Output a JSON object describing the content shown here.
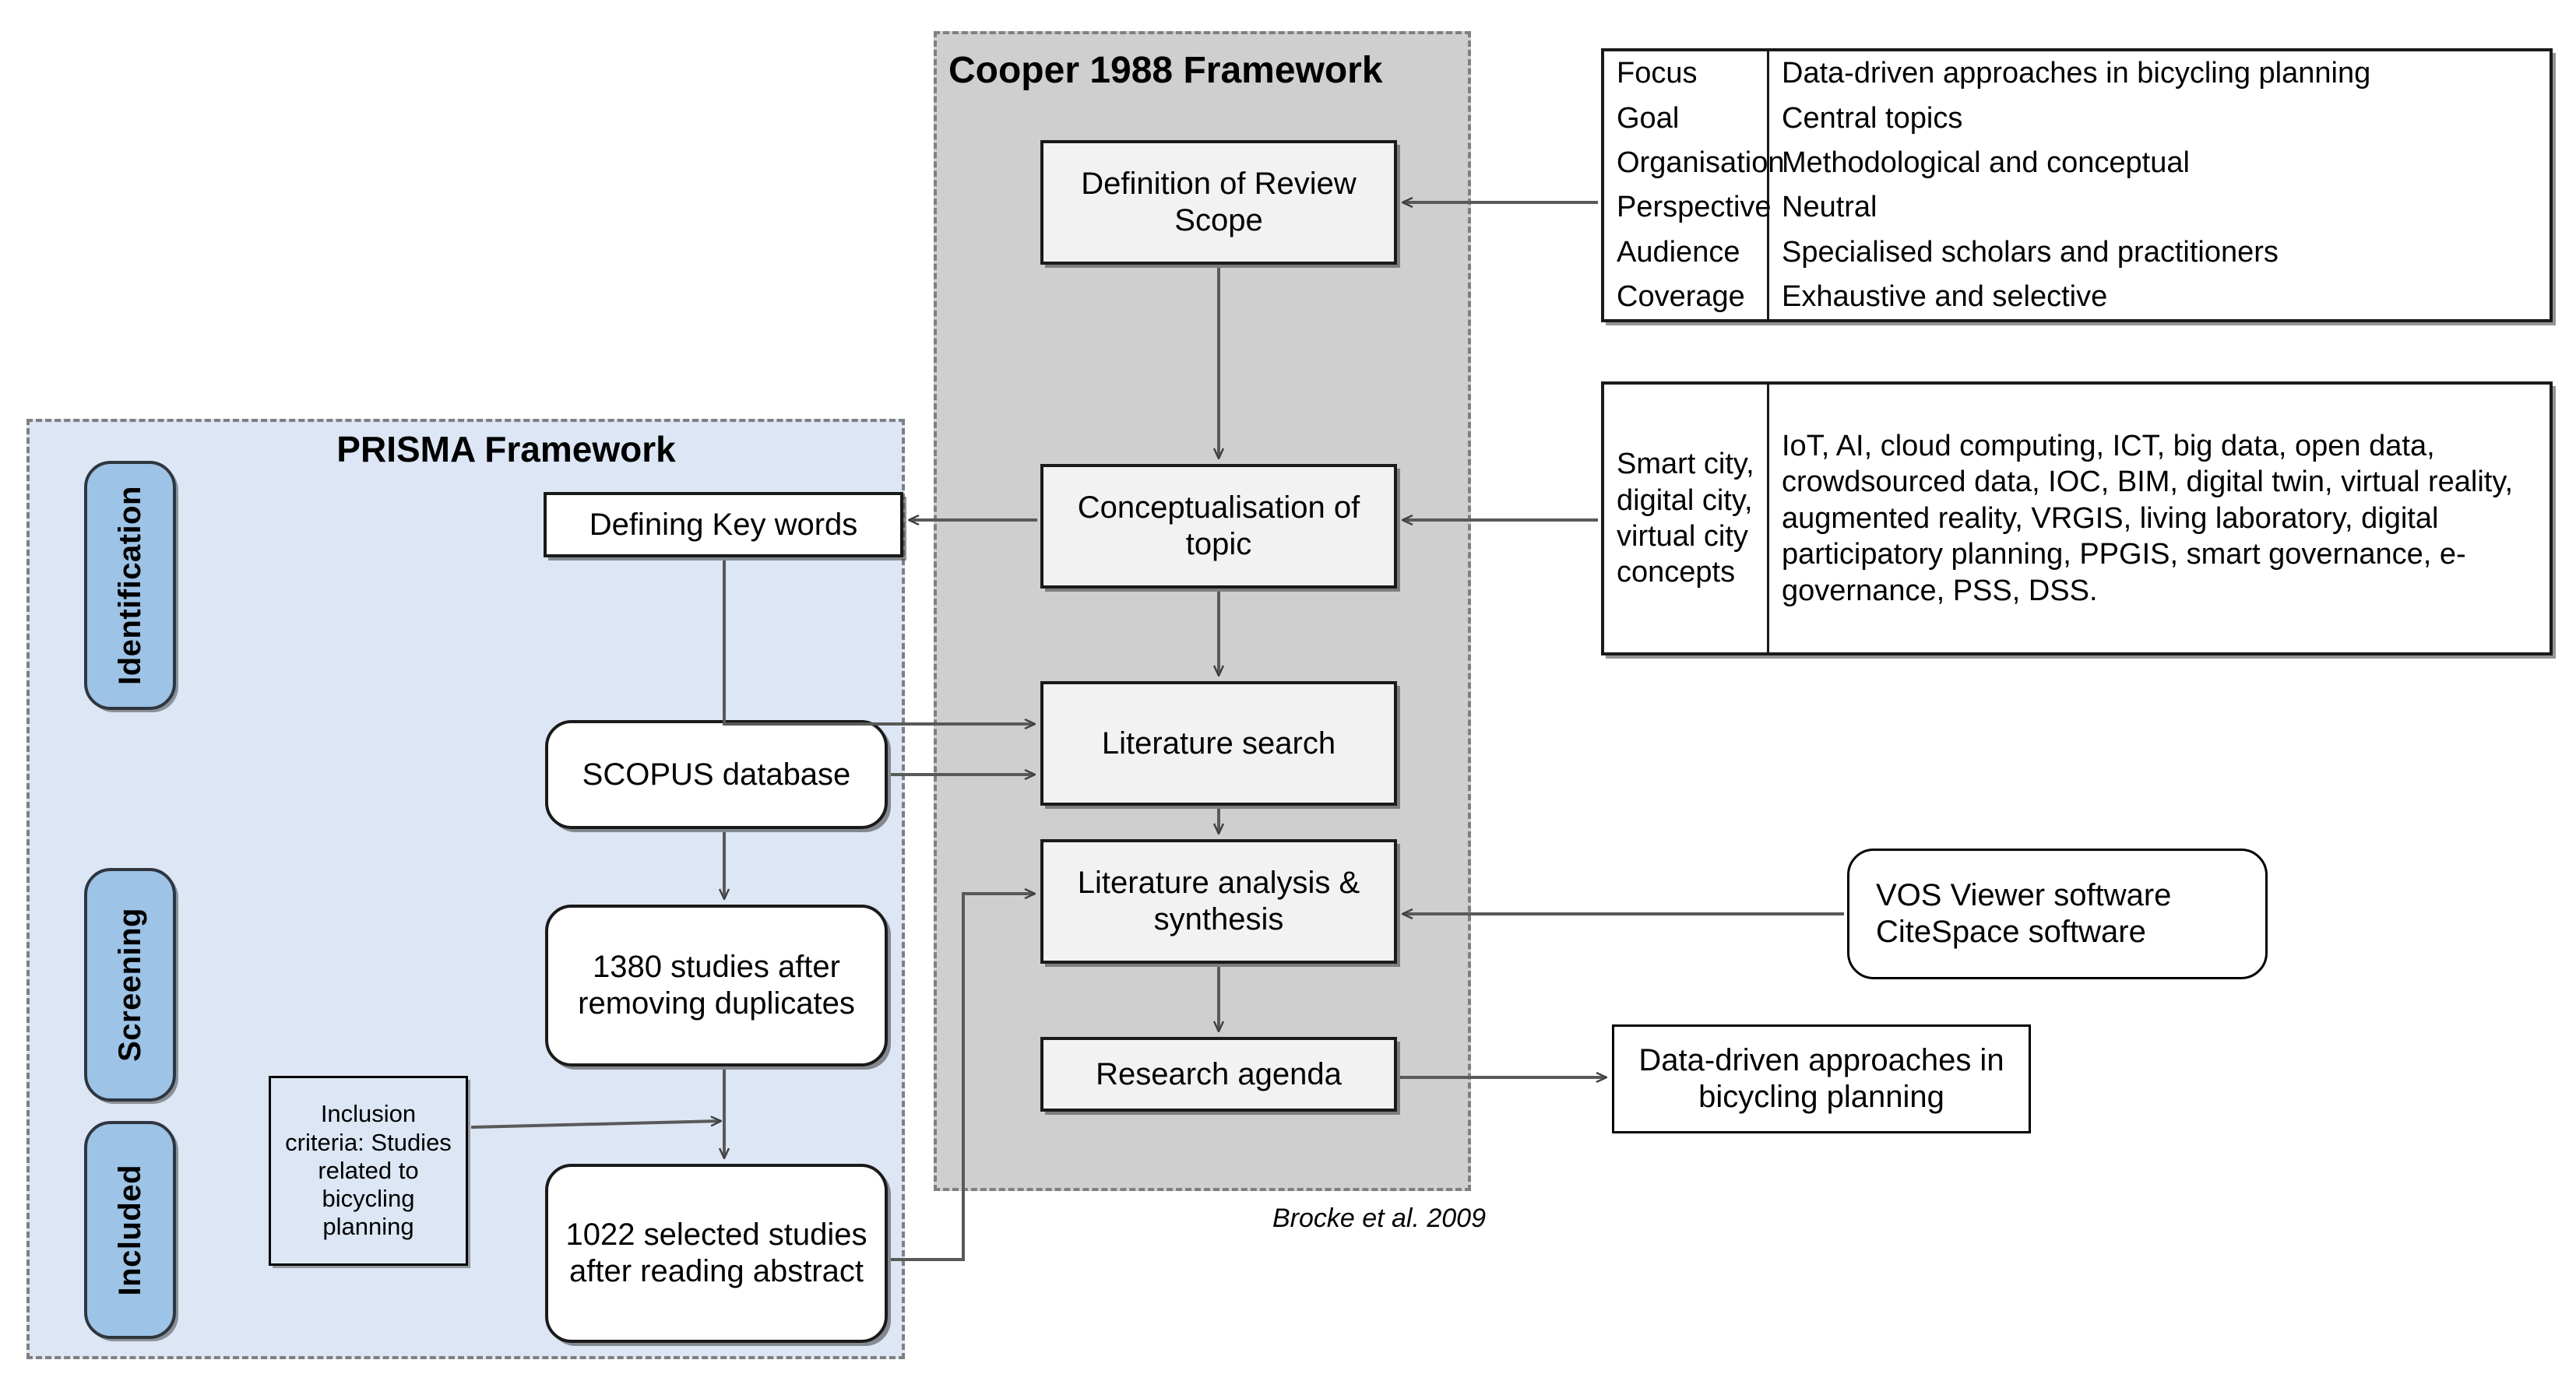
{
  "prisma": {
    "title": "PRISMA Framework",
    "stages": [
      {
        "label": "Identification"
      },
      {
        "label": "Screening"
      },
      {
        "label": "Included"
      }
    ],
    "nodes": {
      "keywords": "Defining Key words",
      "scopus": "SCOPUS database",
      "after_duplicates": "1380 studies after removing duplicates",
      "inclusion_criteria": "Inclusion criteria: Studies related to bicycling planning",
      "selected_studies": "1022 selected studies after reading abstract"
    }
  },
  "cooper": {
    "title": "Cooper 1988 Framework",
    "citation": "Brocke et al. 2009",
    "nodes": {
      "review_scope": "Definition of Review Scope",
      "conceptualisation": "Conceptualisation of topic",
      "lit_search": "Literature search",
      "lit_analysis": "Literature analysis & synthesis",
      "research_agenda": "Research agenda"
    }
  },
  "side": {
    "tools": "VOS Viewer software\nCiteSpace software",
    "outcome": "Data-driven approaches in bicycling planning"
  },
  "table_scope": {
    "rows": [
      {
        "key": "Focus",
        "value": "Data-driven approaches in bicycling planning"
      },
      {
        "key": "Goal",
        "value": "Central topics"
      },
      {
        "key": "Organisation",
        "value": "Methodological and conceptual"
      },
      {
        "key": "Perspective",
        "value": "Neutral"
      },
      {
        "key": "Audience",
        "value": "Specialised scholars and practitioners"
      },
      {
        "key": "Coverage",
        "value": "Exhaustive and selective"
      }
    ]
  },
  "table_concepts": {
    "key": "Smart city, digital city, virtual city concepts",
    "value": "IoT, AI, cloud computing, ICT, big data, open data, crowdsourced data, IOC, BIM, digital twin, virtual reality, augmented reality, VRGIS, living laboratory, digital participatory planning, PPGIS, smart governance, e-governance, PSS, DSS."
  },
  "colors": {
    "prisma_fill": "#dce6f4",
    "prisma_border": "#7f7f7f",
    "cooper_fill": "#cfcfcf",
    "stage_tag_fill": "#9dc3e6",
    "node_fill": "#f2f2f2",
    "line": "#595959"
  }
}
